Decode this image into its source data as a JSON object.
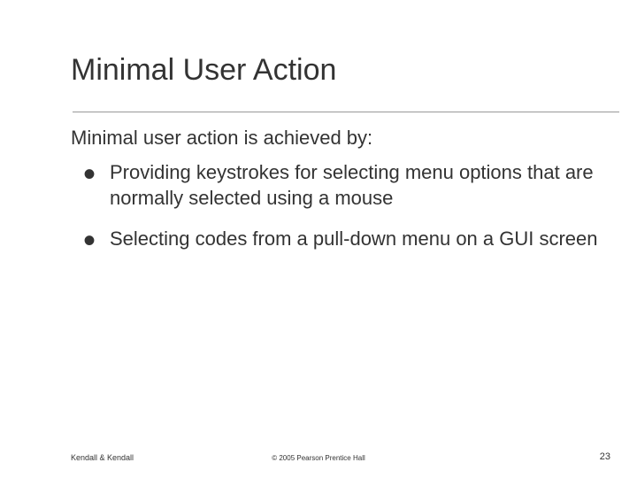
{
  "title": "Minimal User Action",
  "subtitle": "Minimal user action is achieved by:",
  "bullets": [
    " Providing keystrokes for selecting menu options that are normally selected using a mouse",
    "Selecting codes from a pull-down menu on a GUI screen"
  ],
  "footer": {
    "left": "Kendall & Kendall",
    "center": "© 2005 Pearson Prentice Hall",
    "right": "23"
  }
}
